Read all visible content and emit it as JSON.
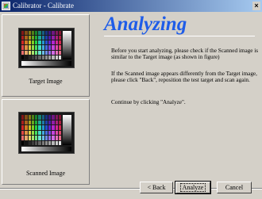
{
  "window": {
    "title": "Calibrator - Calibrate",
    "close_glyph": "×"
  },
  "panels": {
    "target_label": "Target Image",
    "scanned_label": "Scanned Image"
  },
  "content": {
    "heading": "Analyzing",
    "paragraph1": "Before you start analyzing, please check if the Scanned image is similar to the Target image (as shown in figure)",
    "paragraph2": "If the Scanned image appears differently from the Target image, please click \"Back\", reposition the test target and scan again.",
    "paragraph3": "Continue by clicking \"Analyze\"."
  },
  "buttons": {
    "back": "< Back",
    "analyze": "Analyze",
    "cancel": "Cancel"
  },
  "colors": {
    "heading": "#1e5ce8",
    "titlebar_start": "#0a246a",
    "titlebar_end": "#a6caf0",
    "dialog_face": "#d4d0c8"
  },
  "icons": [
    "calibrator-app-icon",
    "close-icon"
  ]
}
